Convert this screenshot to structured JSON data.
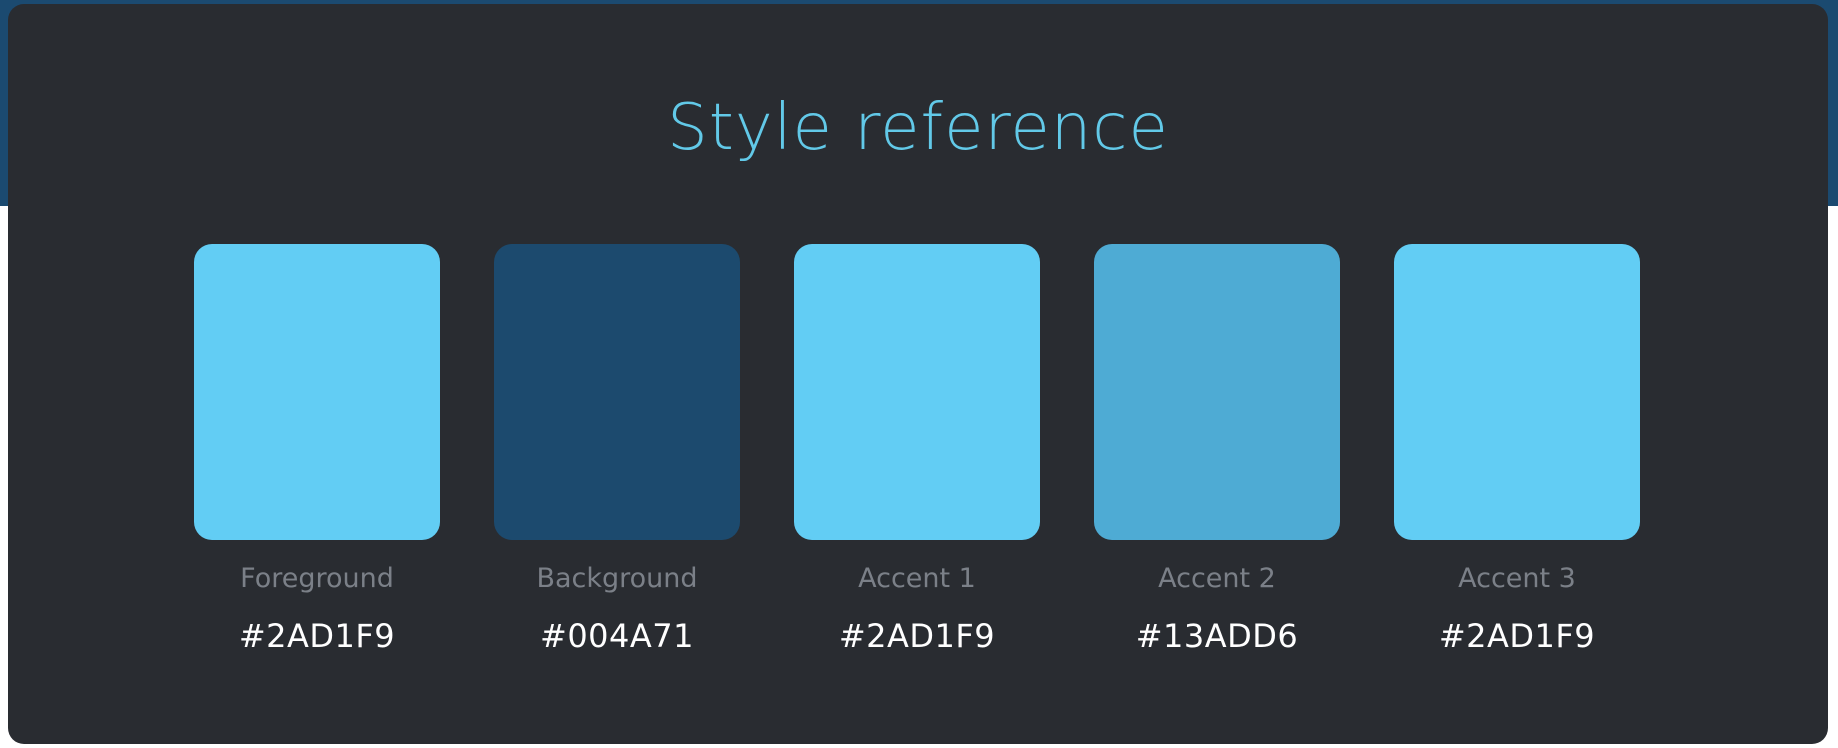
{
  "page": {
    "title": "Style reference"
  },
  "palette": [
    {
      "label": "Foreground",
      "hex": "#2AD1F9",
      "display_color": "#62cdf4"
    },
    {
      "label": "Background",
      "hex": "#004A71",
      "display_color": "#1c4a6e"
    },
    {
      "label": "Accent 1",
      "hex": "#2AD1F9",
      "display_color": "#62cdf4"
    },
    {
      "label": "Accent 2",
      "hex": "#13ADD6",
      "display_color": "#4eabd4"
    },
    {
      "label": "Accent 3",
      "hex": "#2AD1F9",
      "display_color": "#62cdf4"
    }
  ],
  "colors": {
    "band": "#1b4a70",
    "panel": "#292c31",
    "title": "#62c9e8",
    "label": "#7b8088",
    "hex_text": "#ffffff"
  }
}
